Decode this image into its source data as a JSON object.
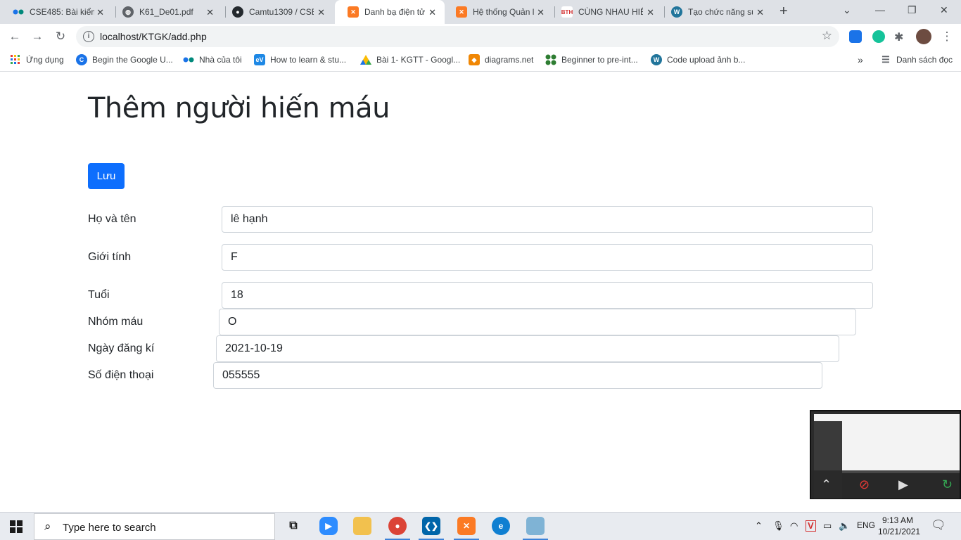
{
  "browser": {
    "tabs": [
      {
        "title": "CSE485: Bài kiểm",
        "icon": "dots-icon",
        "color": "#1a73e8"
      },
      {
        "title": "K61_De01.pdf",
        "icon": "globe-icon",
        "color": "#5f6368"
      },
      {
        "title": "Camtu1309 / CSE",
        "icon": "github-icon",
        "color": "#24292e"
      },
      {
        "title": "Danh bạ điện tử",
        "icon": "xampp-icon",
        "color": "#fb7a24"
      },
      {
        "title": "Hệ thống Quản l",
        "icon": "xampp-icon",
        "color": "#fb7a24"
      },
      {
        "title": "CÙNG NHAU HIỂ",
        "icon": "bth-icon",
        "color": "#d32f2f"
      },
      {
        "title": "Tạo chức năng sử",
        "icon": "wordpress-icon",
        "color": "#21759b"
      }
    ],
    "active_tab": 3,
    "url": "localhost/KTGK/add.php",
    "bookmarks": [
      {
        "label": "Ứng dụng",
        "icon": "apps-grid-icon",
        "color": "#e53935"
      },
      {
        "label": "Begin the Google U...",
        "icon": "google-c-icon",
        "color": "#1a73e8"
      },
      {
        "label": "Nhà của tôi",
        "icon": "dots-icon",
        "color": "#00897b"
      },
      {
        "label": "How to learn & stu...",
        "icon": "ev-icon",
        "color": "#1e88e5"
      },
      {
        "label": "Bài 1- KGTT - Googl...",
        "icon": "drive-icon",
        "color": "#fbbc04"
      },
      {
        "label": "diagrams.net",
        "icon": "drawio-icon",
        "color": "#f08705"
      },
      {
        "label": "Beginner to pre-int...",
        "icon": "clover-icon",
        "color": "#2e7d32"
      },
      {
        "label": "Code upload ảnh b...",
        "icon": "wordpress-icon",
        "color": "#21759b"
      }
    ],
    "more_bookmarks": "»",
    "reading_list": "Danh sách đọc"
  },
  "page": {
    "title": "Thêm người hiến máu",
    "save_label": "Lưu",
    "fields": [
      {
        "label": "Họ và tên",
        "value": "lê hạnh"
      },
      {
        "label": "Giới tính",
        "value": "F"
      },
      {
        "label": "Tuổi",
        "value": "18"
      },
      {
        "label": "Nhóm máu",
        "value": "O"
      },
      {
        "label": "Ngày đăng kí",
        "value": "2021-10-19"
      },
      {
        "label": "Số điện thoại",
        "value": "055555"
      }
    ]
  },
  "taskbar": {
    "search_placeholder": "Type here to search",
    "language": "ENG",
    "time": "9:13 AM",
    "date": "10/21/2021"
  }
}
